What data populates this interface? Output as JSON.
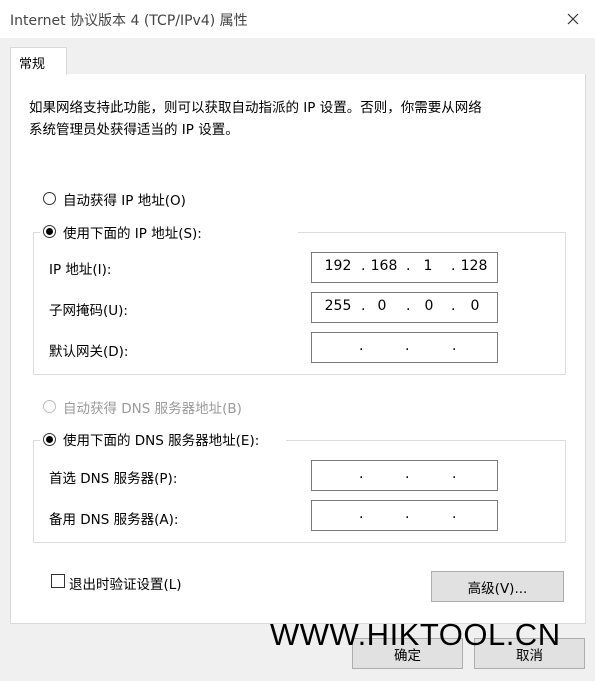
{
  "window": {
    "title": "Internet 协议版本 4 (TCP/IPv4) 属性",
    "close_icon": "close-icon"
  },
  "tabs": [
    {
      "label": "常规"
    }
  ],
  "description": {
    "line1": "如果网络支持此功能，则可以获取自动指派的 IP 设置。否则，你需要从网络",
    "line2": "系统管理员处获得适当的 IP 设置。"
  },
  "ip_section": {
    "auto_label": "自动获得 IP 地址(O)",
    "manual_label": "使用下面的 IP 地址(S):",
    "selected": "manual",
    "ip_label": "IP 地址(I):",
    "ip_value": [
      "192",
      "168",
      "1",
      "128"
    ],
    "subnet_label": "子网掩码(U):",
    "subnet_value": [
      "255",
      "0",
      "0",
      "0"
    ],
    "gateway_label": "默认网关(D):",
    "gateway_value": [
      "",
      "",
      "",
      ""
    ]
  },
  "dns_section": {
    "auto_label": "自动获得 DNS 服务器地址(B)",
    "manual_label": "使用下面的 DNS 服务器地址(E):",
    "selected": "manual",
    "preferred_label": "首选 DNS 服务器(P):",
    "preferred_value": [
      "",
      "",
      "",
      ""
    ],
    "alternate_label": "备用 DNS 服务器(A):",
    "alternate_value": [
      "",
      "",
      "",
      ""
    ]
  },
  "validate": {
    "label": "退出时验证设置(L)",
    "checked": false
  },
  "buttons": {
    "advanced": "高级(V)...",
    "ok": "确定",
    "cancel": "取消"
  },
  "watermark": "WWW.HIKTOOL.CN"
}
